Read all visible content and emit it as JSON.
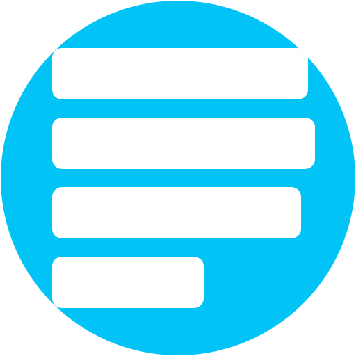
{
  "icon": {
    "name": "list-lines-icon",
    "colors": {
      "circle": "#02c3f6",
      "bars": "#ffffff",
      "background": "#ffffff"
    },
    "bar_count": 4
  }
}
